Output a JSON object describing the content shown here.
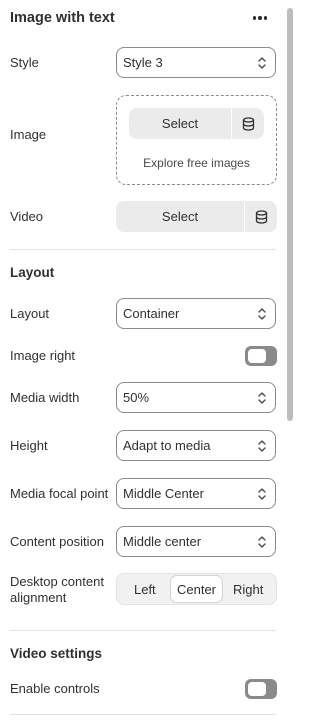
{
  "header": {
    "title": "Image with text",
    "more_icon": "more-horizontal-icon"
  },
  "style": {
    "label": "Style",
    "value": "Style 3"
  },
  "image": {
    "label": "Image",
    "select_label": "Select",
    "explore_label": "Explore free images",
    "library_icon": "database-icon"
  },
  "video": {
    "label": "Video",
    "select_label": "Select",
    "library_icon": "database-icon"
  },
  "layout_section": {
    "title": "Layout"
  },
  "layout": {
    "label": "Layout",
    "value": "Container"
  },
  "image_right": {
    "label": "Image right",
    "enabled": false
  },
  "media_width": {
    "label": "Media width",
    "value": "50%"
  },
  "height": {
    "label": "Height",
    "value": "Adapt to media"
  },
  "media_focal_point": {
    "label": "Media focal point",
    "value": "Middle Center"
  },
  "content_position": {
    "label": "Content position",
    "value": "Middle center"
  },
  "desktop_alignment": {
    "label_line1": "Desktop content",
    "label_line2": "alignment",
    "options": [
      "Left",
      "Center",
      "Right"
    ],
    "selected": "Center"
  },
  "video_section": {
    "title": "Video settings"
  },
  "enable_controls": {
    "label": "Enable controls",
    "enabled": false
  },
  "colors": {
    "text": "#303030",
    "border": "#8a8a8a",
    "button_bg": "#ebebeb",
    "toggle_off": "#8a8a8a",
    "divider": "#e3e3e3"
  }
}
